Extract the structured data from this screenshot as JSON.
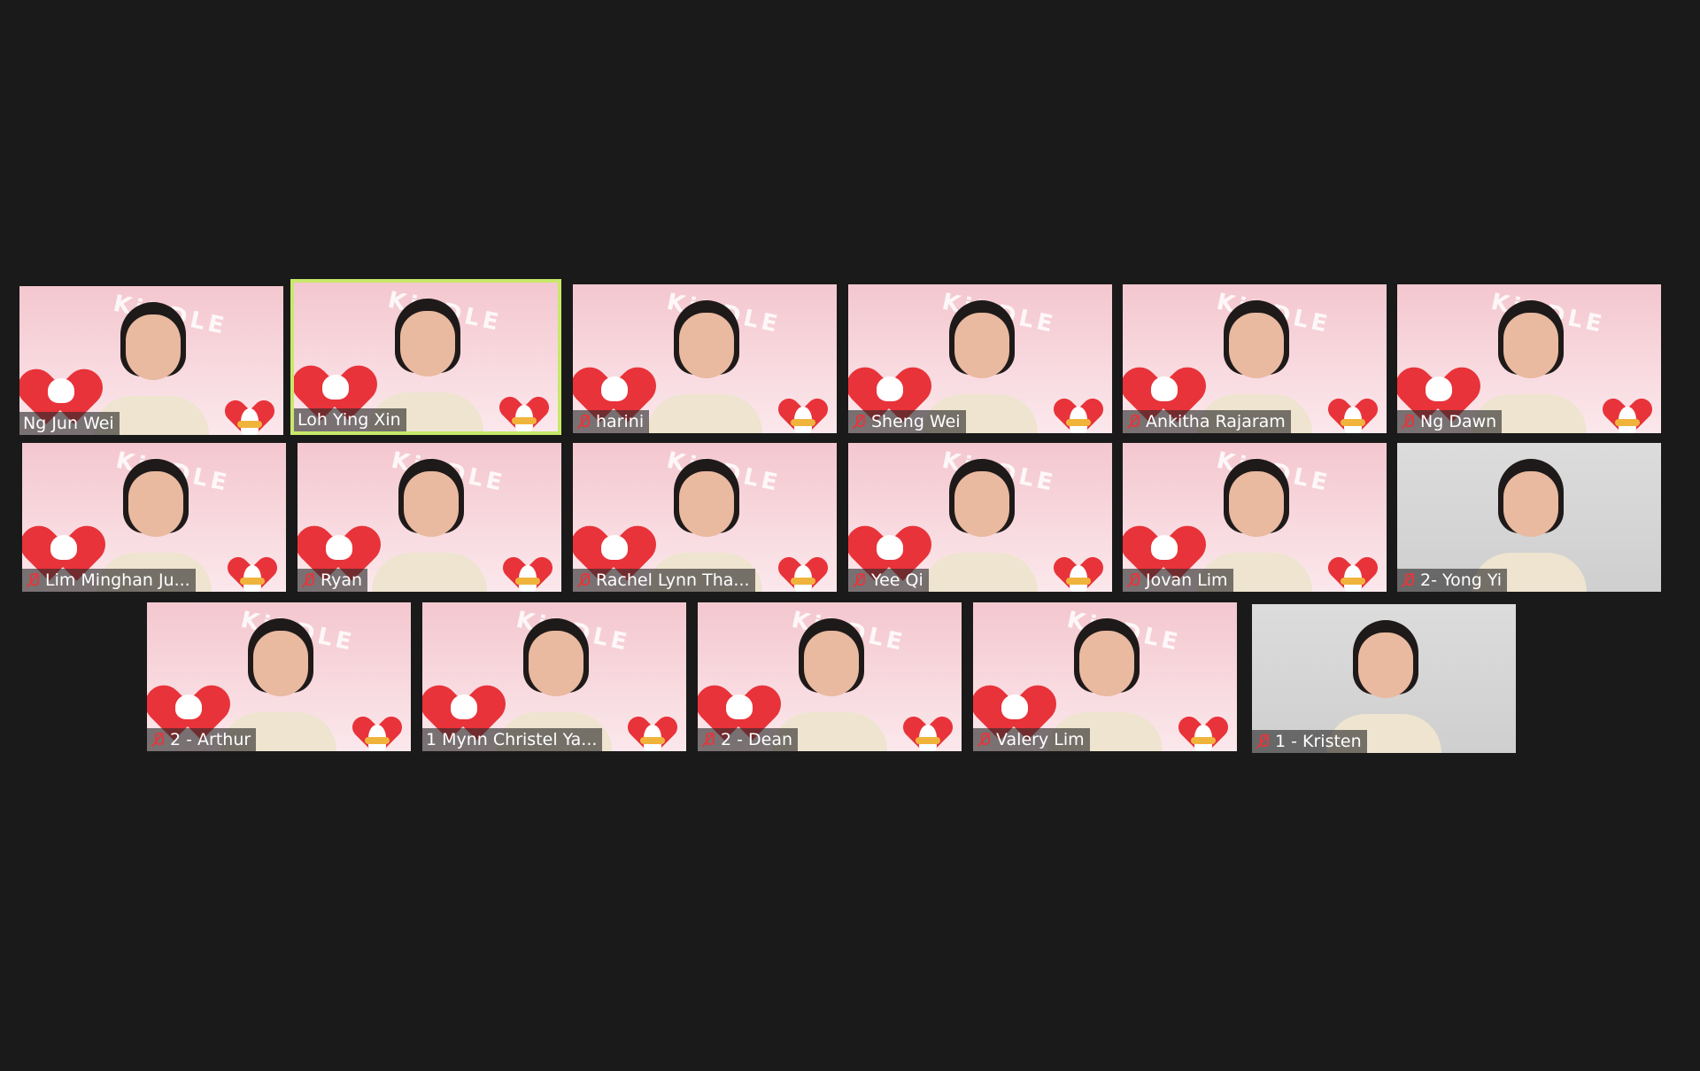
{
  "accent": {
    "muted_icon_color": "#e0393e",
    "speaking_border_color": "#c8e86a",
    "background": "#1a1a1a"
  },
  "participants": [
    {
      "name": "Ng Jun Wei",
      "muted": false,
      "speaking": false,
      "bg": "kindle"
    },
    {
      "name": "Loh Ying Xin",
      "muted": false,
      "speaking": true,
      "bg": "kindle"
    },
    {
      "name": "harini",
      "muted": true,
      "speaking": false,
      "bg": "kindle"
    },
    {
      "name": "Sheng Wei",
      "muted": true,
      "speaking": false,
      "bg": "kindle"
    },
    {
      "name": "Ankitha Rajaram",
      "muted": true,
      "speaking": false,
      "bg": "kindle"
    },
    {
      "name": "Ng Dawn",
      "muted": true,
      "speaking": false,
      "bg": "kindle"
    },
    {
      "name": "Lim Minghan Ju...",
      "muted": true,
      "speaking": false,
      "bg": "kindle"
    },
    {
      "name": "Ryan",
      "muted": true,
      "speaking": false,
      "bg": "kindle"
    },
    {
      "name": "Rachel Lynn Tha...",
      "muted": true,
      "speaking": false,
      "bg": "kindle"
    },
    {
      "name": "Yee Qi",
      "muted": true,
      "speaking": false,
      "bg": "kindle"
    },
    {
      "name": "Jovan Lim",
      "muted": true,
      "speaking": false,
      "bg": "kindle"
    },
    {
      "name": "2- Yong Yi",
      "muted": true,
      "speaking": false,
      "bg": "plain"
    },
    {
      "name": "2 - Arthur",
      "muted": true,
      "speaking": false,
      "bg": "kindle"
    },
    {
      "name": "1 Mynn Christel Ya...",
      "muted": false,
      "speaking": false,
      "bg": "kindle"
    },
    {
      "name": "2 - Dean",
      "muted": true,
      "speaking": false,
      "bg": "kindle"
    },
    {
      "name": "Valery Lim",
      "muted": true,
      "speaking": false,
      "bg": "kindle"
    },
    {
      "name": "1 - Kristen",
      "muted": true,
      "speaking": false,
      "bg": "plain"
    }
  ],
  "watermark_text": "KiNDLE"
}
